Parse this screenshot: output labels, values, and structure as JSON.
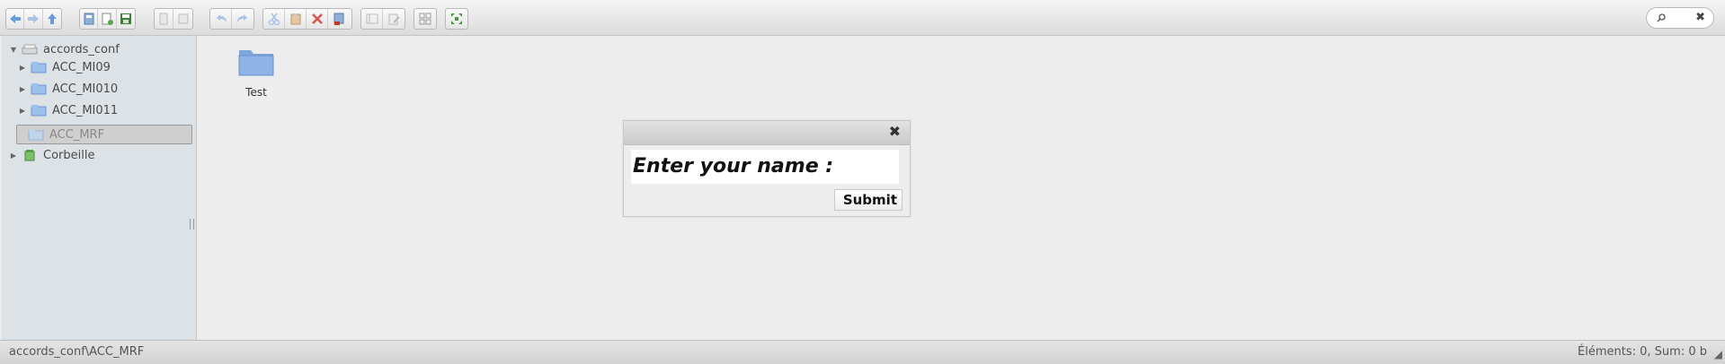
{
  "toolbar": {
    "buttons": [
      {
        "name": "back-icon"
      },
      {
        "name": "forward-icon"
      },
      {
        "name": "up-icon"
      },
      {
        "name": "reload-icon"
      },
      {
        "name": "new-file-icon"
      },
      {
        "name": "save-icon"
      },
      {
        "name": "open-icon"
      },
      {
        "name": "save-disabled-icon"
      },
      {
        "name": "undo-icon"
      },
      {
        "name": "redo-icon"
      },
      {
        "name": "cut-icon"
      },
      {
        "name": "paste-icon"
      },
      {
        "name": "delete-icon"
      },
      {
        "name": "info-icon"
      },
      {
        "name": "properties-icon"
      },
      {
        "name": "edit-icon"
      },
      {
        "name": "grid-view-icon"
      },
      {
        "name": "fullscreen-icon"
      }
    ]
  },
  "sidebar": {
    "root": {
      "label": "accords_conf"
    },
    "items": [
      {
        "label": "ACC_MI09"
      },
      {
        "label": "ACC_MI010"
      },
      {
        "label": "ACC_MI011"
      },
      {
        "label": "ACC_MRF"
      },
      {
        "label": "Corbeille"
      }
    ]
  },
  "main": {
    "folder": {
      "label": "Test"
    }
  },
  "dialog": {
    "close_glyph": "✖",
    "prompt": "Enter your name :",
    "submit_label": "Submit"
  },
  "status": {
    "path": "accords_conf\\ACC_MRF",
    "summary": "Éléments: 0, Sum: 0 b"
  },
  "colors": {
    "accent_blue": "#5b8fd6",
    "folder_blue": "#8eb3e6",
    "trash_green": "#5aa64a"
  }
}
